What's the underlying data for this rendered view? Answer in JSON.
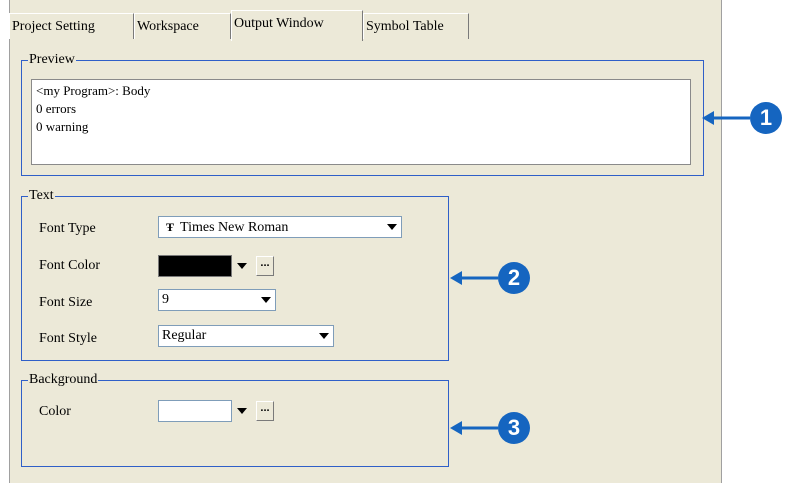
{
  "tabs": [
    {
      "label": "Project Setting",
      "active": false
    },
    {
      "label": "Workspace",
      "active": false
    },
    {
      "label": "Output Window",
      "active": true
    },
    {
      "label": "Symbol Table",
      "active": false
    }
  ],
  "preview": {
    "legend": "Preview",
    "lines": [
      "<my Program>: Body",
      "0 errors",
      "0 warning"
    ]
  },
  "text_group": {
    "legend": "Text",
    "font_type_label": "Font Type",
    "font_type_value": "Times New Roman",
    "font_type_icon": "truetype-font-icon",
    "font_color_label": "Font Color",
    "font_color_value": "#000000",
    "font_size_label": "Font Size",
    "font_size_value": "9",
    "font_style_label": "Font Style",
    "font_style_value": "Regular",
    "ellipsis": "..."
  },
  "background_group": {
    "legend": "Background",
    "color_label": "Color",
    "color_value": "#ffffff",
    "ellipsis": "..."
  },
  "callouts": [
    "1",
    "2",
    "3"
  ],
  "colors": {
    "dialog_bg": "#ece9d8",
    "group_border": "#2f5fc8",
    "callout": "#1565c0"
  }
}
